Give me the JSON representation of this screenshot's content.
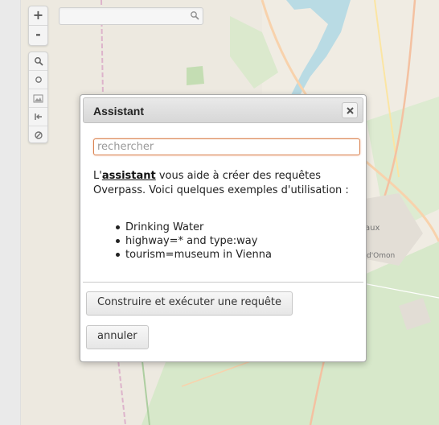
{
  "map": {
    "labels": {
      "right_a": "aux",
      "right_b": "d'Omon"
    }
  },
  "controls": {
    "zoom_in": "+",
    "zoom_out": "-",
    "tools": [
      "search-icon",
      "circle-icon",
      "image-icon",
      "first-page-icon",
      "clear-icon"
    ]
  },
  "dialog": {
    "title": "Assistant",
    "search_placeholder": "rechercher",
    "intro_prefix": "L'",
    "intro_link": "assistant",
    "intro_rest": " vous aide à créer des requêtes Overpass. Voici quelques exemples d'utilisation :",
    "examples": [
      "Drinking Water",
      "highway=* and type:way",
      "tourism=museum in Vienna"
    ],
    "build_label": "Construire et exécuter une requête",
    "cancel_label": "annuler"
  }
}
